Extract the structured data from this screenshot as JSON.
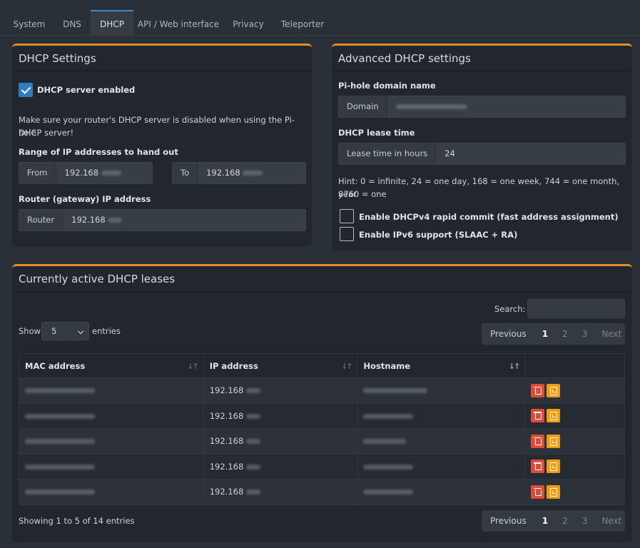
{
  "tabs": [
    "System",
    "DNS",
    "DHCP",
    "API / Web interface",
    "Privacy",
    "Teleporter"
  ],
  "dhcp_settings": {
    "title": "DHCP Settings",
    "enabled_label": "DHCP server enabled",
    "enabled": true,
    "warning_line1": "Make sure your router's DHCP server is disabled when using the Pi-hole",
    "warning_line2": "DHCP server!",
    "range_label": "Range of IP addresses to hand out",
    "from_addon": "From",
    "from_value": "192.168",
    "to_addon": "To",
    "to_value": "192.168",
    "router_label": "Router (gateway) IP address",
    "router_addon": "Router",
    "router_value": "192.168"
  },
  "advanced": {
    "title": "Advanced DHCP settings",
    "domain_label": "Pi-hole domain name",
    "domain_addon": "Domain",
    "lease_label": "DHCP lease time",
    "lease_addon": "Lease time in hours",
    "lease_value": "24",
    "hint_line1": "Hint: 0 = infinite, 24 = one day, 168 = one week, 744 = one month, 8760 = one",
    "hint_line2": "year",
    "rapid_commit_label": "Enable DHCPv4 rapid commit (fast address assignment)",
    "rapid_commit": false,
    "ipv6_label": "Enable IPv6 support (SLAAC + RA)",
    "ipv6": false
  },
  "leases": {
    "title": "Currently active DHCP leases",
    "search_label": "Search:",
    "show_label": "Show",
    "show_value": "5",
    "entries_label": "entries",
    "pager": {
      "previous": "Previous",
      "pages": [
        "1",
        "2",
        "3"
      ],
      "next": "Next",
      "current": "1"
    },
    "columns": [
      "MAC address",
      "IP address",
      "Hostname"
    ],
    "rows": [
      {
        "ip": "192.168"
      },
      {
        "ip": "192.168"
      },
      {
        "ip": "192.168"
      },
      {
        "ip": "192.168"
      },
      {
        "ip": "192.168"
      }
    ],
    "info": "Showing 1 to 5 of 14 entries"
  },
  "colors": {
    "accent": "#e08e2c",
    "primary": "#3c8dbc",
    "danger": "#dd4b39",
    "warning": "#f39c12"
  }
}
